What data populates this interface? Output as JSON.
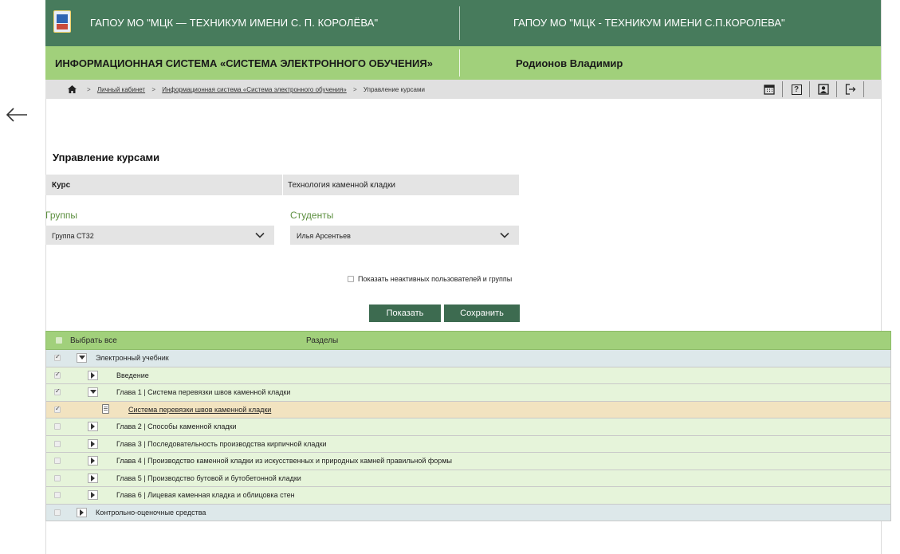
{
  "header": {
    "org_left": "ГАПОУ МО \"МЦК — ТЕХНИКУМ ИМЕНИ С. П. КОРОЛЁВА\"",
    "org_right": "ГАПОУ МО \"МЦК - ТЕХНИКУМ ИМЕНИ С.П.КОРОЛЕВА\"",
    "system_title": "ИНФОРМАЦИОННАЯ СИСТЕМА «СИСТЕМА ЭЛЕКТРОННОГО ОБУЧЕНИЯ»",
    "user_name": "Родионов Владимир"
  },
  "breadcrumb": {
    "items": [
      "Личный кабинет",
      "Информационная система «Система электронного обучения»",
      "Управление курсами"
    ],
    "separator": ">"
  },
  "toolbar": {
    "icons": [
      "calendar-icon",
      "help-icon",
      "profile-icon",
      "logout-icon"
    ],
    "help_glyph": "?"
  },
  "page": {
    "title": "Управление курсами",
    "course_label": "Курс",
    "course_value": "Технология каменной кладки",
    "groups_label": "Группы",
    "groups_selected": "Группа СТ32",
    "students_label": "Студенты",
    "students_selected": "Илья Арсентьев",
    "show_inactive_label": "Показать неактивных пользователей и группы",
    "show_inactive_checked": false,
    "show_button": "Показать",
    "save_button": "Сохранить"
  },
  "tree": {
    "select_all_label": "Выбрать все",
    "sections_header": "Разделы",
    "rows": [
      {
        "label": "Электронный учебник",
        "checked": true,
        "toggle": "expanded",
        "level": 0,
        "style": "gray"
      },
      {
        "label": "Введение",
        "checked": true,
        "toggle": "collapsed",
        "level": 1,
        "style": "green"
      },
      {
        "label": "Глава 1 | Система перевязки швов каменной кладки",
        "checked": true,
        "toggle": "expanded",
        "level": 1,
        "style": "green"
      },
      {
        "label": "Система перевязки швов каменной кладки",
        "checked": true,
        "toggle": "document",
        "level": 2,
        "style": "yellow"
      },
      {
        "label": "Глава 2 | Способы каменной кладки",
        "checked": false,
        "toggle": "collapsed",
        "level": 1,
        "style": "green"
      },
      {
        "label": "Глава 3 | Последовательность производства кирпичной кладки",
        "checked": false,
        "toggle": "collapsed",
        "level": 1,
        "style": "green"
      },
      {
        "label": "Глава 4 | Производство каменной кладки из искусственных и природных камней правильной формы",
        "checked": false,
        "toggle": "collapsed",
        "level": 1,
        "style": "green"
      },
      {
        "label": "Глава 5 | Производство бутовой и бутобетонной кладки",
        "checked": false,
        "toggle": "collapsed",
        "level": 1,
        "style": "green"
      },
      {
        "label": "Глава 6 | Лицевая каменная кладка и облицовка стен",
        "checked": false,
        "toggle": "collapsed",
        "level": 1,
        "style": "green"
      },
      {
        "label": "Контрольно-оценочные средства",
        "checked": false,
        "toggle": "collapsed",
        "level": 0,
        "style": "gray"
      }
    ]
  },
  "colors": {
    "header_dark": "#477b5c",
    "header_light": "#a1d07b",
    "button": "#3d6b50",
    "label_green": "#5c8f3f"
  }
}
